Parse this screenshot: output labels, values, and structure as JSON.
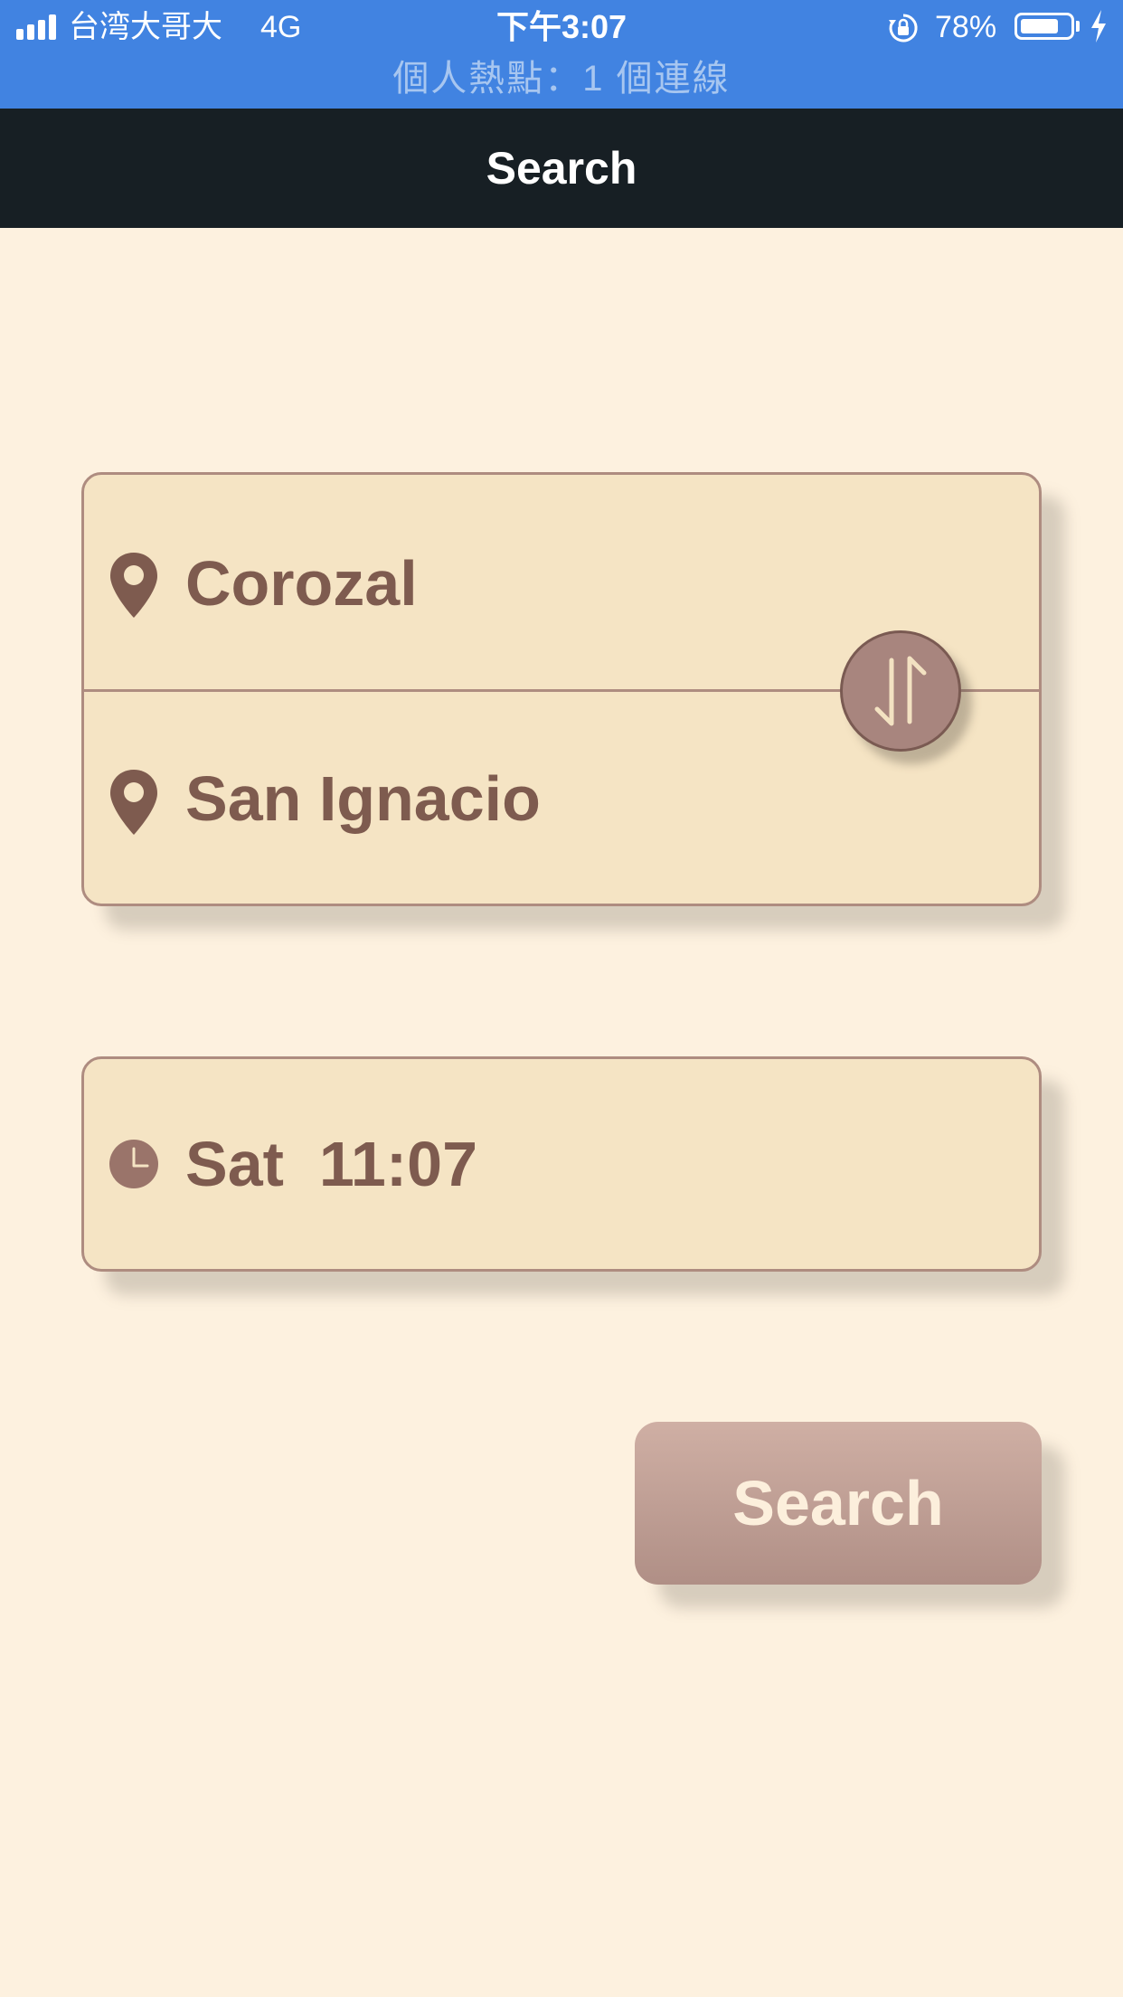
{
  "status_bar": {
    "carrier": "台湾大哥大",
    "network": "4G",
    "time": "下午3:07",
    "battery_percent": "78%",
    "battery_level": 0.78,
    "hotspot_text": "個人熱點：1 個連線",
    "background_color": "#4183E1"
  },
  "nav": {
    "title": "Search",
    "background_color": "#171F24"
  },
  "route": {
    "origin": "Corozal",
    "destination": "San Ignacio",
    "origin_icon": "location-pin-icon",
    "destination_icon": "location-pin-icon",
    "swap_icon": "swap-arrows-icon"
  },
  "departure": {
    "time_text": "Sat  11:07",
    "icon": "clock-icon"
  },
  "actions": {
    "search_label": "Search"
  },
  "colors": {
    "page_background": "#FDF1DF",
    "card_background": "#F5E4C4",
    "card_border": "#AE8C80",
    "text_brown": "#7E5B4F",
    "button_top": "#CFAFA4",
    "button_bottom": "#B08F86",
    "button_text": "#FCEFDC"
  }
}
